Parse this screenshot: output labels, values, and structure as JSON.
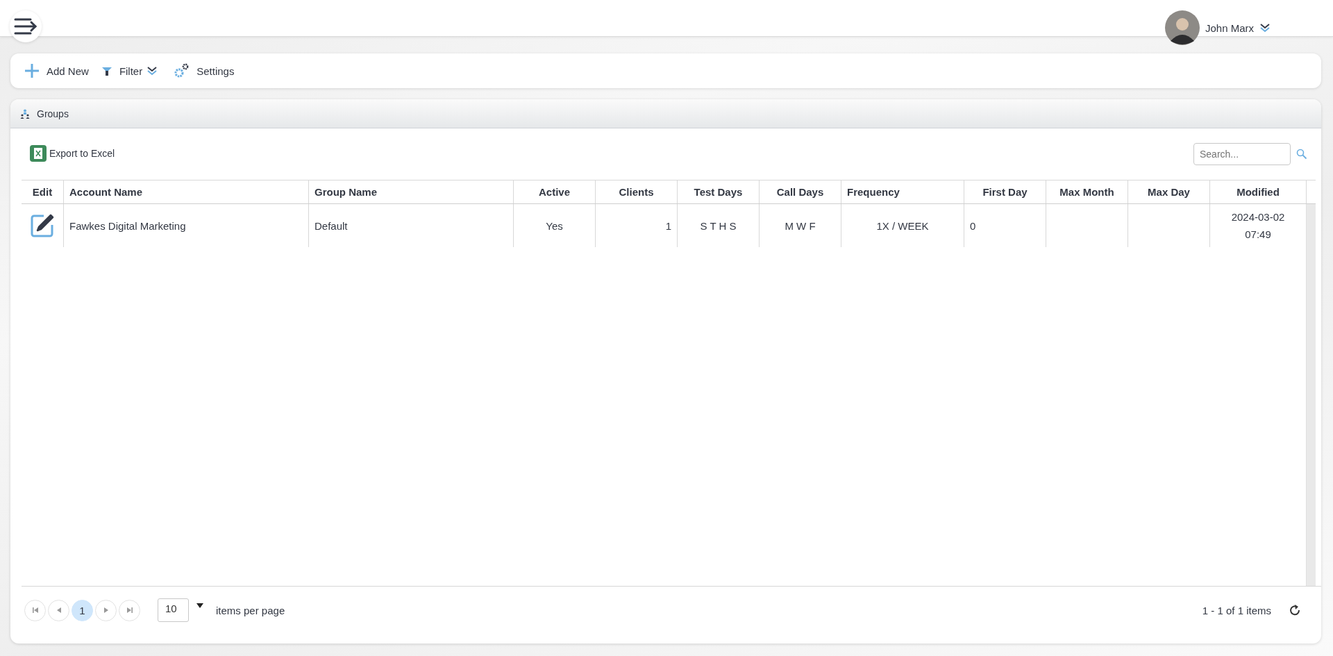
{
  "header": {
    "user_name": "John Marx"
  },
  "toolbar": [
    {
      "kind": "add",
      "label": "Add New"
    },
    {
      "kind": "filter",
      "label": "Filter"
    },
    {
      "kind": "settings",
      "label": "Settings"
    }
  ],
  "panel": {
    "title": "Groups"
  },
  "export": {
    "label": "Export to Excel"
  },
  "search": {
    "placeholder": "Search..."
  },
  "table": {
    "columns": [
      "Edit",
      "Account Name",
      "Group Name",
      "Active",
      "Clients",
      "Test Days",
      "Call Days",
      "Frequency",
      "First Day",
      "Max Month",
      "Max Day",
      "Modified"
    ],
    "rows": [
      {
        "cells": [
          "",
          "Fawkes Digital Marketing",
          "Default",
          "Yes",
          "1",
          "S T H S",
          "M W F",
          "1X / WEEK",
          "0",
          "",
          "",
          "2024-03-02\n07:49"
        ]
      }
    ]
  },
  "pager": {
    "pages": [
      {
        "label": "1",
        "selected": true
      }
    ],
    "page_size": "10",
    "page_size_label": "items per page",
    "summary": "1 - 1 of 1 items"
  }
}
